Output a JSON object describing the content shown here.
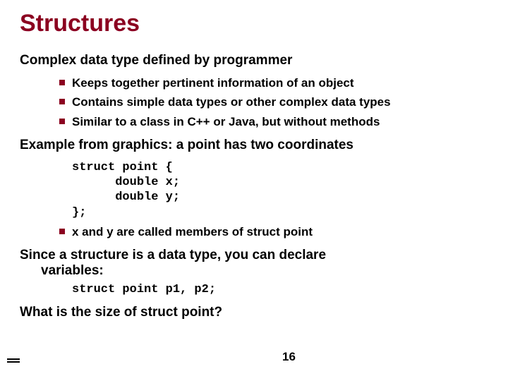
{
  "title": "Structures",
  "section1": {
    "heading": "Complex data type defined by programmer",
    "bullets": [
      "Keeps together pertinent information of an object",
      "Contains simple data types or other complex data types",
      "Similar to a class in C++ or Java, but without methods"
    ]
  },
  "section2": {
    "heading": "Example from graphics:  a point has two coordinates",
    "code": "struct point {\n      double x;\n      double y;\n};",
    "bullet": "x and y are called members of struct point"
  },
  "section3": {
    "heading_line1": "Since a structure is a data type, you can declare",
    "heading_line2": "variables:",
    "code": "struct point p1, p2;"
  },
  "question": "What is the size of struct point?",
  "page": "16"
}
